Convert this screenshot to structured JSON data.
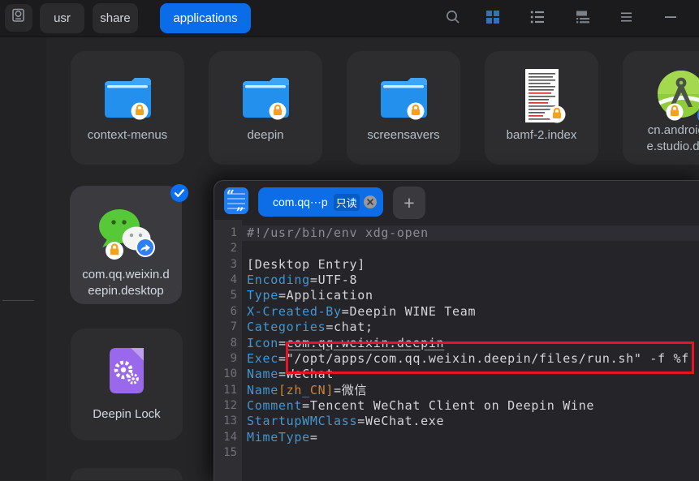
{
  "toolbar": {
    "crumbs": {
      "usr": "usr",
      "share": "share",
      "applications": "applications"
    },
    "icons": [
      "disk",
      "search",
      "grid-view",
      "list-view",
      "detail-view",
      "menu",
      "minimize"
    ],
    "accent_color": "#0a6ce8"
  },
  "files": {
    "items": [
      {
        "label": "context-menus",
        "icon": "folder",
        "lock": true
      },
      {
        "label": "deepin",
        "icon": "folder",
        "lock": true
      },
      {
        "label": "screensavers",
        "icon": "folder",
        "lock": true
      },
      {
        "label": "bamf-2.index",
        "icon": "text-document",
        "lock": true
      },
      {
        "label_line1": "cn.androidg",
        "label_line2": "e.studio.des",
        "icon": "android-studio",
        "lock": true
      },
      {
        "label_line1": "com.qq.weixin.d",
        "label_line2": "eepin.desktop",
        "icon": "wechat",
        "lock": true,
        "share": true,
        "selected": true
      },
      {
        "label": "Deepin Lock",
        "icon": "deepin-lock"
      }
    ]
  },
  "editor": {
    "tab": {
      "title": "com.qq⋯p",
      "readonly_badge": "只读"
    },
    "plus_label": "+",
    "annotation": {
      "color": "#ec1127"
    },
    "lines": [
      [
        {
          "c": "c",
          "t": "#!/usr/bin/env xdg-open"
        }
      ],
      [],
      [
        {
          "c": "p",
          "t": "[Desktop Entry]"
        }
      ],
      [
        {
          "c": "k",
          "t": "Encoding"
        },
        {
          "c": "p",
          "t": "=UTF-8"
        }
      ],
      [
        {
          "c": "k",
          "t": "Type"
        },
        {
          "c": "p",
          "t": "=Application"
        }
      ],
      [
        {
          "c": "k",
          "t": "X-Created-By"
        },
        {
          "c": "p",
          "t": "=Deepin WINE Team"
        }
      ],
      [
        {
          "c": "k",
          "t": "Categories"
        },
        {
          "c": "p",
          "t": "=chat;"
        }
      ],
      [
        {
          "c": "k",
          "t": "Icon"
        },
        {
          "c": "p",
          "t": "="
        },
        {
          "c": "u",
          "t": "com.qq.weixin.deepin"
        }
      ],
      [
        {
          "c": "k",
          "t": "Exec"
        },
        {
          "c": "p",
          "t": "="
        },
        {
          "c": "p",
          "t": "\"/opt/apps/com.qq.weixin.deepin/files/run.sh\" -f %f"
        }
      ],
      [
        {
          "c": "k",
          "t": "Name"
        },
        {
          "c": "p",
          "t": "=WeChat"
        }
      ],
      [
        {
          "c": "k",
          "t": "Name"
        },
        {
          "c": "o",
          "t": "[zh_CN]"
        },
        {
          "c": "p",
          "t": "=微信"
        }
      ],
      [
        {
          "c": "k",
          "t": "Comment"
        },
        {
          "c": "p",
          "t": "=Tencent WeChat Client on Deepin Wine"
        }
      ],
      [
        {
          "c": "k",
          "t": "StartupWMClass"
        },
        {
          "c": "p",
          "t": "=WeChat.exe"
        }
      ],
      [
        {
          "c": "k",
          "t": "MimeType"
        },
        {
          "c": "p",
          "t": "="
        }
      ],
      []
    ]
  }
}
